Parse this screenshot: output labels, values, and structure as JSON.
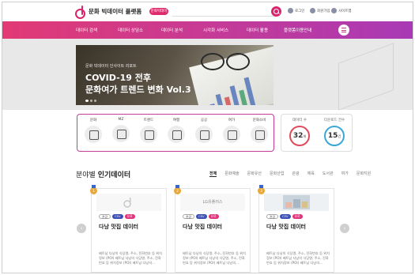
{
  "brand": {
    "logo_text": "문화 빅데이터 플랫폼",
    "badge": "문화빅데이터",
    "accent_color": "#d8246b",
    "nav_gradient": [
      "#e23a74",
      "#a93ab5"
    ]
  },
  "search": {
    "placeholder": "",
    "value": ""
  },
  "util": [
    {
      "label": "로그인",
      "icon": "login-icon"
    },
    {
      "label": "회원가입",
      "icon": "join-icon"
    },
    {
      "label": "사이트맵",
      "icon": "sitemap-icon"
    }
  ],
  "nav": [
    "데이터 검색",
    "데이터 상담소",
    "데이터 분석",
    "시각화 서비스",
    "데이터 활용",
    "플랫폼이용안내"
  ],
  "hero": {
    "kicker": "문화 빅데이터 인사이트 리포트",
    "title_line1": "COVID-19 전후",
    "title_line2": "문화여가 트렌드 변화 Vol.3"
  },
  "categories": [
    {
      "label": "문화",
      "icon": "culture-icon"
    },
    {
      "label": "MZ",
      "icon": "mz-icon"
    },
    {
      "label": "트렌드",
      "icon": "trend-icon"
    },
    {
      "label": "여행",
      "icon": "travel-icon"
    },
    {
      "label": "공공",
      "icon": "public-icon"
    },
    {
      "label": "여가",
      "icon": "leisure-icon"
    },
    {
      "label": "문화소비",
      "icon": "consumption-icon"
    }
  ],
  "stats": [
    {
      "label": "데이터 수",
      "value": "32",
      "unit": "개"
    },
    {
      "label": "다운로드 건수",
      "value": "15",
      "unit": "건"
    }
  ],
  "section": {
    "title_prefix": "분야별",
    "title_bold": "인기데이터"
  },
  "tabs": [
    "전체",
    "문화예술",
    "문화유산",
    "문화산업",
    "관광",
    "체육",
    "도서관",
    "여가",
    "문화지원"
  ],
  "cards": [
    {
      "rank": "1",
      "thumb": "",
      "tags": [
        "관광",
        "CSV",
        "유료"
      ],
      "title": "다낭 맛집 데이터",
      "desc": "베트남 다낭의 식당명, 주소, 전화번호 등 위치정보 (POI) 베트남 다낭의 식당명, 주소, 전화번호 등 위치정보 (POI) 베트남 다낭의..."
    },
    {
      "rank": "2",
      "thumb": "LG유플러스",
      "tags": [
        "관광",
        "CSV",
        "유료"
      ],
      "title": "다낭 맛집 데이터",
      "desc": "베트남 다낭의 식당명, 주소, 전화번호 등 위치정보 (POI) 베트남 다낭의 식당명, 주소, 전화번호 등 위치정보 (POI) 베트남 다낭의..."
    },
    {
      "rank": "3",
      "thumb": "",
      "tags": [
        "관광",
        "CSV",
        "유료"
      ],
      "title": "다낭 맛집 데이터",
      "desc": "베트남 다낭의 식당명, 주소, 전화번호 등 위치정보 (POI) 베트남 다낭의 식당명, 주소, 전화번호 등 위치정보 (POI) 베트남 다낭의..."
    }
  ],
  "carousel": {
    "prev": "‹",
    "next": "›"
  }
}
